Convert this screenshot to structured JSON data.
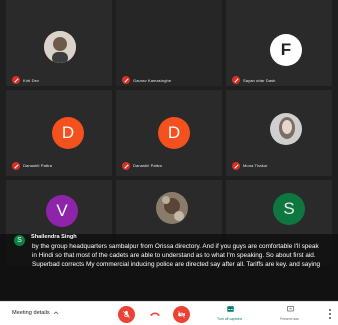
{
  "participants": [
    {
      "name": "Kirti Dev",
      "avatar_type": "photo",
      "initial": ""
    },
    {
      "name": "Gaurav Kamasinghe",
      "avatar_type": "none",
      "initial": ""
    },
    {
      "name": "Sayan ottar Dash",
      "avatar_type": "letter",
      "initial": "F"
    },
    {
      "name": "Danashit Pattra",
      "avatar_type": "letter",
      "initial": "D"
    },
    {
      "name": "Danashil Pattra",
      "avatar_type": "letter",
      "initial": "D"
    },
    {
      "name": "Mona Thakur",
      "avatar_type": "photo",
      "initial": ""
    },
    {
      "name": "Shailendra Singh",
      "avatar_type": "letter",
      "initial": "V"
    },
    {
      "name": "",
      "avatar_type": "photo",
      "initial": ""
    },
    {
      "name": "",
      "avatar_type": "letter",
      "initial": "S"
    }
  ],
  "colors": {
    "orange_avatar": "#f4511e",
    "purple_avatar": "#8e24aa",
    "green_avatar": "#0b8043",
    "white_avatar": "#ffffff",
    "mic_off": "#d93025",
    "end_call": "#ea4335",
    "teal_accent": "#00796b"
  },
  "captions": {
    "speaker_initial": "S",
    "speaker_name": "Shailendra Singh",
    "text": "by the group headquarters sambalpur from Orissa directory. And if you guys are comfortable I'll speak in Hindi so that most of the cadets are able to understand as to what I'm speaking. So about first aid. Superbad corrects My commercial inducing police are directed say after all. Tariffs are key. and saying"
  },
  "toolbar": {
    "meeting_details": "Meeting details",
    "turn_off_captions": "Turn off captions",
    "present_now": "Present now",
    "chevron_icon": "chevron-up-icon",
    "mic_icon": "mic-off-icon",
    "hangup_icon": "call-end-icon",
    "camera_icon": "camera-off-icon",
    "more_icon": "more-vert-icon"
  }
}
